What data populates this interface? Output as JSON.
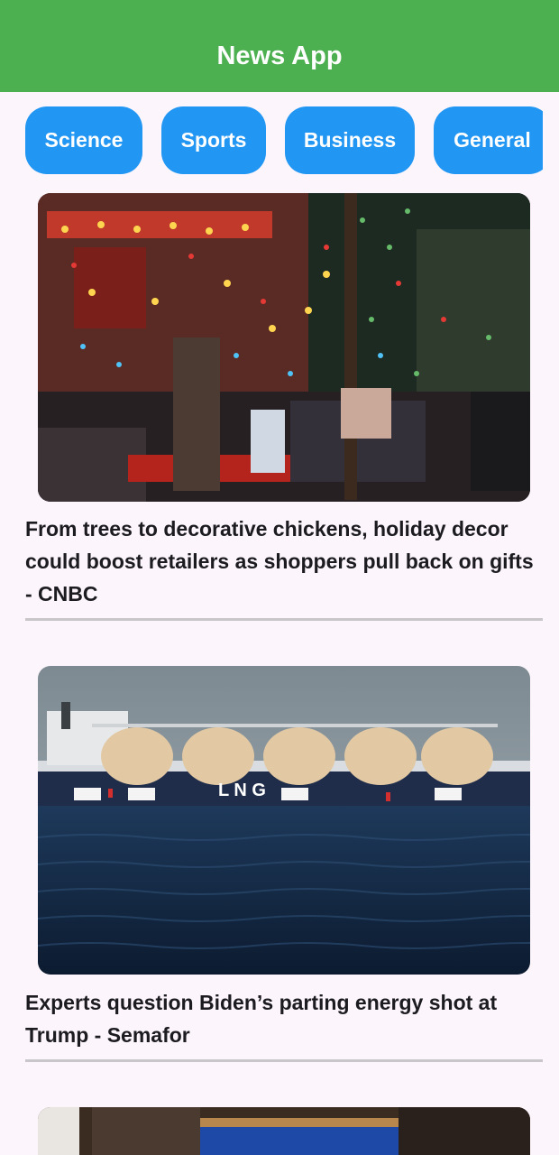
{
  "app": {
    "title": "News App"
  },
  "categories": [
    "Science",
    "Sports",
    "Business",
    "General"
  ],
  "articles": [
    {
      "title": "From trees to decorative chickens, holiday decor could boost retailers as shoppers pull back on gifts - CNBC",
      "image_icon": "holiday-lights-house-image"
    },
    {
      "title": "Experts question Biden’s parting energy shot at Trump - Semafor",
      "image_icon": "lng-tanker-ship-image",
      "image_text": "L N G"
    },
    {
      "title": "",
      "image_icon": "news-photo-image"
    }
  ]
}
